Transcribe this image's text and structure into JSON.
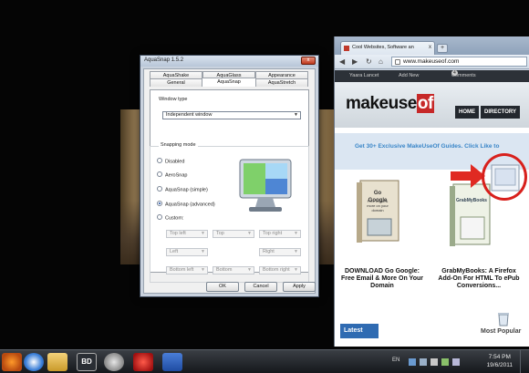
{
  "dialog": {
    "title": "AquaSnap 1.5.2",
    "close_glyph": "x",
    "tabs_row1": [
      "AquaShake",
      "AquaGlass",
      "Appearance"
    ],
    "tabs_row2": [
      "General",
      "AquaSnap",
      "AquaStretch"
    ],
    "active_tab": "AquaSnap",
    "window_type_label": "Window type",
    "window_type_value": "Independent window",
    "snapping_mode_label": "Snapping mode",
    "snapping_modes": [
      "Disabled",
      "AeroSnap",
      "AquaSnap (simple)",
      "AquaSnap (advanced)",
      "Custom:"
    ],
    "selected_mode": "AquaSnap (advanced)",
    "custom_grid": [
      "Top left",
      "Top",
      "Top right",
      "Left",
      "Right",
      "Bottom left",
      "Bottom",
      "Bottom right"
    ],
    "buttons": {
      "ok": "OK",
      "cancel": "Cancel",
      "apply": "Apply"
    }
  },
  "browser": {
    "tab_title": "Cool Websites, Software an",
    "tab_close": "x",
    "new_tab": "+",
    "url": "www.makeuseof.com",
    "bookmarks": {
      "user": "Yaara Lancet",
      "add_new": "Add New",
      "comments": "Comments",
      "comments_count": "4"
    },
    "site": {
      "logo_main": "makeuse",
      "logo_of": "of",
      "nav": [
        "HOME",
        "DIRECTORY"
      ],
      "promo": "Get 30+ Exclusive MakeUseOf Guides. Click Like to",
      "book1_cover_title": "Go Google",
      "book1_cover_sub": "Free email & more on your domain",
      "book1_title": "DOWNLOAD Go Google: Free Email & More On Your Domain",
      "book2_cover_title": "GrabMyBooks",
      "book2_title": "GrabMyBooks: A Firefox Add-On For HTML To ePub Conversions...",
      "latest": "Latest",
      "most_popular": "Most Popular"
    }
  },
  "taskbar": {
    "pinned": [
      "firefox-icon",
      "chrome-icon",
      "explorer-icon",
      "bd-app-icon",
      "cd-icon",
      "media-icon",
      "word-icon"
    ],
    "bd_label": "BD",
    "lang": "EN",
    "time": "7:54 PM",
    "date": "19/6/2011"
  },
  "colors": {
    "accent_red": "#d8201c",
    "site_blue": "#2f6bb2",
    "promo_blue": "#3a86c8"
  }
}
